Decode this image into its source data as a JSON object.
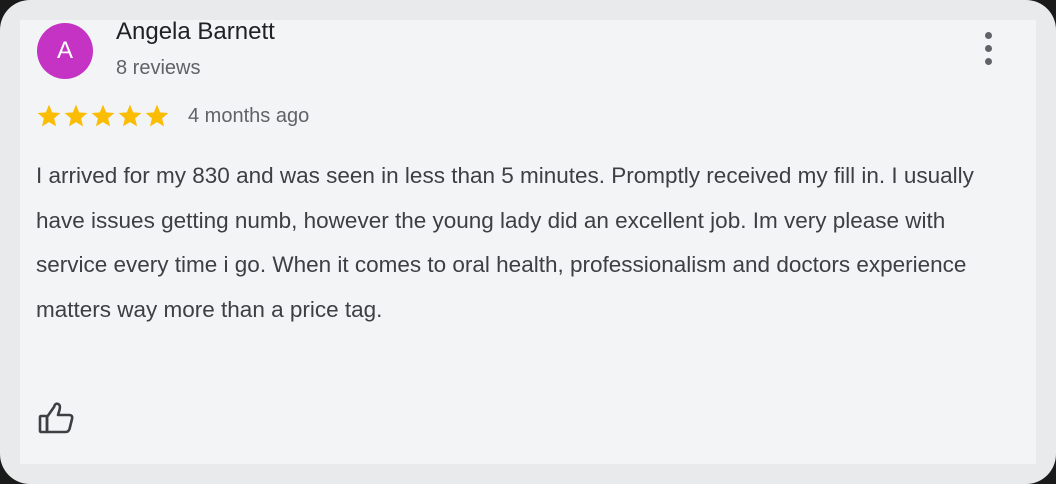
{
  "review": {
    "author": {
      "initial": "A",
      "name": "Angela Barnett",
      "reviews_label": "8 reviews",
      "avatar_color": "#c433c4"
    },
    "rating": 5,
    "max_rating": 5,
    "star_color": "#fbbc04",
    "date": "4 months ago",
    "text": "I arrived for my 830 and was seen in less than 5 minutes. Promptly received my fill in. I usually have issues getting numb, however the young lady did an excellent job. Im very please with service every time i go. When it comes to oral health, professionalism and doctors experience matters way more than a price tag.",
    "icons": {
      "menu": "more-vert-icon",
      "like": "thumb-up-icon",
      "star": "star-icon"
    }
  }
}
